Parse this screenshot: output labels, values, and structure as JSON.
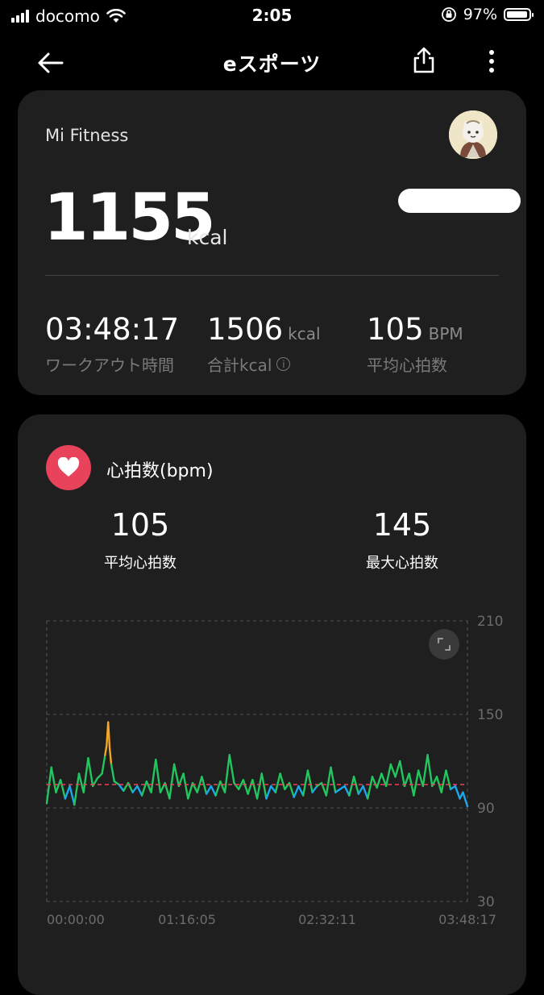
{
  "status_bar": {
    "carrier": "docomo",
    "time": "2:05",
    "battery": "97%",
    "battery_level": 0.97
  },
  "header": {
    "title": "eスポーツ"
  },
  "summary": {
    "app_name": "Mi Fitness",
    "active_kcal": "1155",
    "active_kcal_unit": "kcal",
    "stats": [
      {
        "value": "03:48:17",
        "unit": "",
        "label": "ワークアウト時間"
      },
      {
        "value": "1506",
        "unit": "kcal",
        "label": "合計kcal"
      },
      {
        "value": "105",
        "unit": "BPM",
        "label": "平均心拍数"
      }
    ]
  },
  "heart_rate": {
    "title": "心拍数(bpm)",
    "avg_value": "105",
    "avg_label": "平均心拍数",
    "max_value": "145",
    "max_label": "最大心拍数"
  },
  "chart_data": {
    "type": "line",
    "title": "",
    "x_ticks": [
      "00:00:00",
      "01:16:05",
      "02:32:11",
      "03:48:17"
    ],
    "y_ticks": [
      210,
      150,
      90,
      30
    ],
    "ylim": [
      30,
      210
    ],
    "x_range_seconds": [
      0,
      13697
    ],
    "average_line": 105,
    "zone_colors": {
      "low": "#1aa7ef",
      "mid": "#22c55e",
      "high": "#f5a623"
    },
    "zone_thresholds": [
      106,
      127
    ],
    "series": [
      {
        "x": [
          0,
          150,
          300,
          450,
          600,
          750,
          900,
          1050,
          1200,
          1350,
          1500,
          1650,
          1800,
          1900,
          1950,
          2000,
          2050,
          2100,
          2200,
          2350,
          2500,
          2650,
          2800,
          2950,
          3100,
          3250,
          3400,
          3550,
          3700,
          3850,
          4000,
          4150,
          4300,
          4450,
          4600,
          4750,
          4900,
          5050,
          5200,
          5350,
          5500,
          5650,
          5800,
          5950,
          6100,
          6250,
          6400,
          6550,
          6700,
          6850,
          7000,
          7150,
          7300,
          7450,
          7600,
          7750,
          7900,
          8050,
          8200,
          8350,
          8500,
          8650,
          8800,
          8950,
          9100,
          9250,
          9400,
          9550,
          9700,
          9850,
          10000,
          10150,
          10300,
          10450,
          10600,
          10750,
          10900,
          11050,
          11200,
          11350,
          11500,
          11650,
          11800,
          11950,
          12100,
          12250,
          12400,
          12550,
          12700,
          12850,
          13000,
          13150,
          13300,
          13450,
          13550,
          13697
        ],
        "values": [
          93,
          116,
          100,
          108,
          96,
          104,
          92,
          112,
          100,
          122,
          104,
          109,
          112,
          124,
          130,
          145,
          128,
          118,
          107,
          105,
          101,
          106,
          100,
          104,
          98,
          107,
          100,
          121,
          100,
          106,
          96,
          118,
          104,
          112,
          96,
          106,
          100,
          110,
          99,
          104,
          98,
          107,
          100,
          124,
          106,
          102,
          108,
          99,
          108,
          96,
          112,
          96,
          104,
          100,
          112,
          102,
          106,
          97,
          104,
          98,
          114,
          100,
          104,
          106,
          98,
          116,
          100,
          102,
          104,
          98,
          110,
          99,
          104,
          96,
          110,
          103,
          112,
          104,
          118,
          110,
          120,
          104,
          112,
          98,
          114,
          104,
          124,
          104,
          110,
          100,
          114,
          102,
          104,
          96,
          100,
          91
        ]
      }
    ]
  }
}
